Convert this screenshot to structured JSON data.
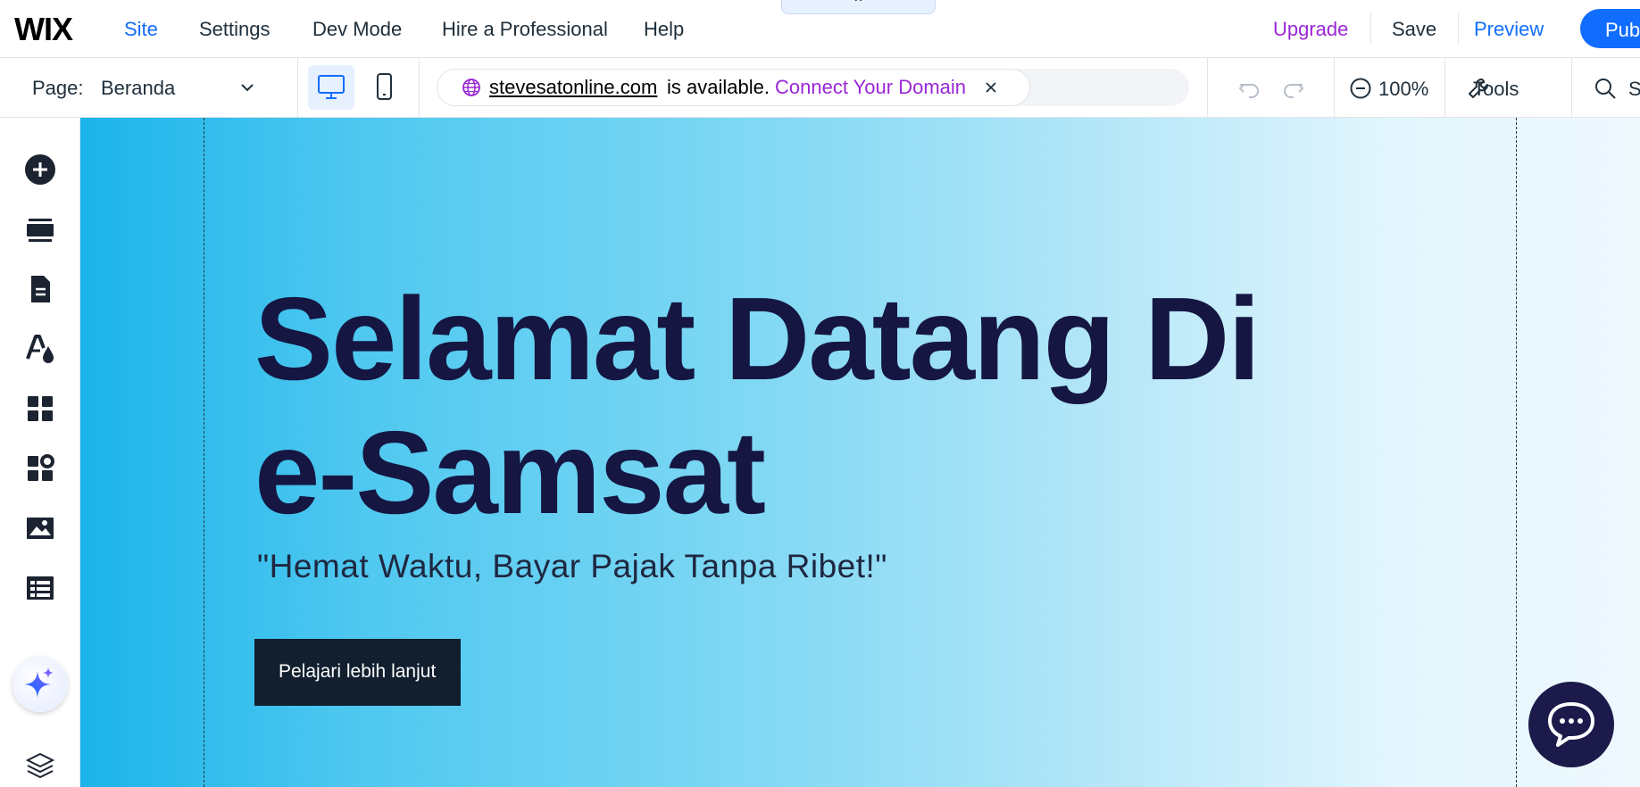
{
  "brand": {
    "logo": "WIX"
  },
  "top_menu": {
    "items": [
      {
        "label": "Site",
        "active": true
      },
      {
        "label": "Settings"
      },
      {
        "label": "Dev Mode"
      },
      {
        "label": "Hire a Professional"
      },
      {
        "label": "Help"
      }
    ],
    "upgrade": "Upgrade",
    "save": "Save",
    "preview": "Preview",
    "publish": "Publ"
  },
  "toolbar": {
    "page_label": "Page:",
    "page_value": "Beranda",
    "domain": {
      "name": "stevesatonline.com",
      "status": "is available.",
      "connect": "Connect Your Domain"
    },
    "zoom": "100%",
    "tools": "Tools",
    "search": "S"
  },
  "hero": {
    "title_line1": "Selamat Datang Di",
    "title_line2": "e-Samsat",
    "subtitle": "\"Hemat Waktu, Bayar Pajak Tanpa Ribet!\"",
    "cta": "Pelajari lebih lanjut"
  },
  "colors": {
    "accent": "#116dff",
    "upgrade": "#9a27d5",
    "hero_title": "#151642",
    "cta_bg": "#111f2e",
    "chat_bg": "#1b1a4a"
  },
  "icons": {
    "left_rail": [
      "add-icon",
      "sections-icon",
      "pages-icon",
      "design-icon",
      "apps-icon",
      "business-apps-icon",
      "media-icon",
      "cms-icon",
      "ai-assistant-icon",
      "layers-icon"
    ]
  }
}
